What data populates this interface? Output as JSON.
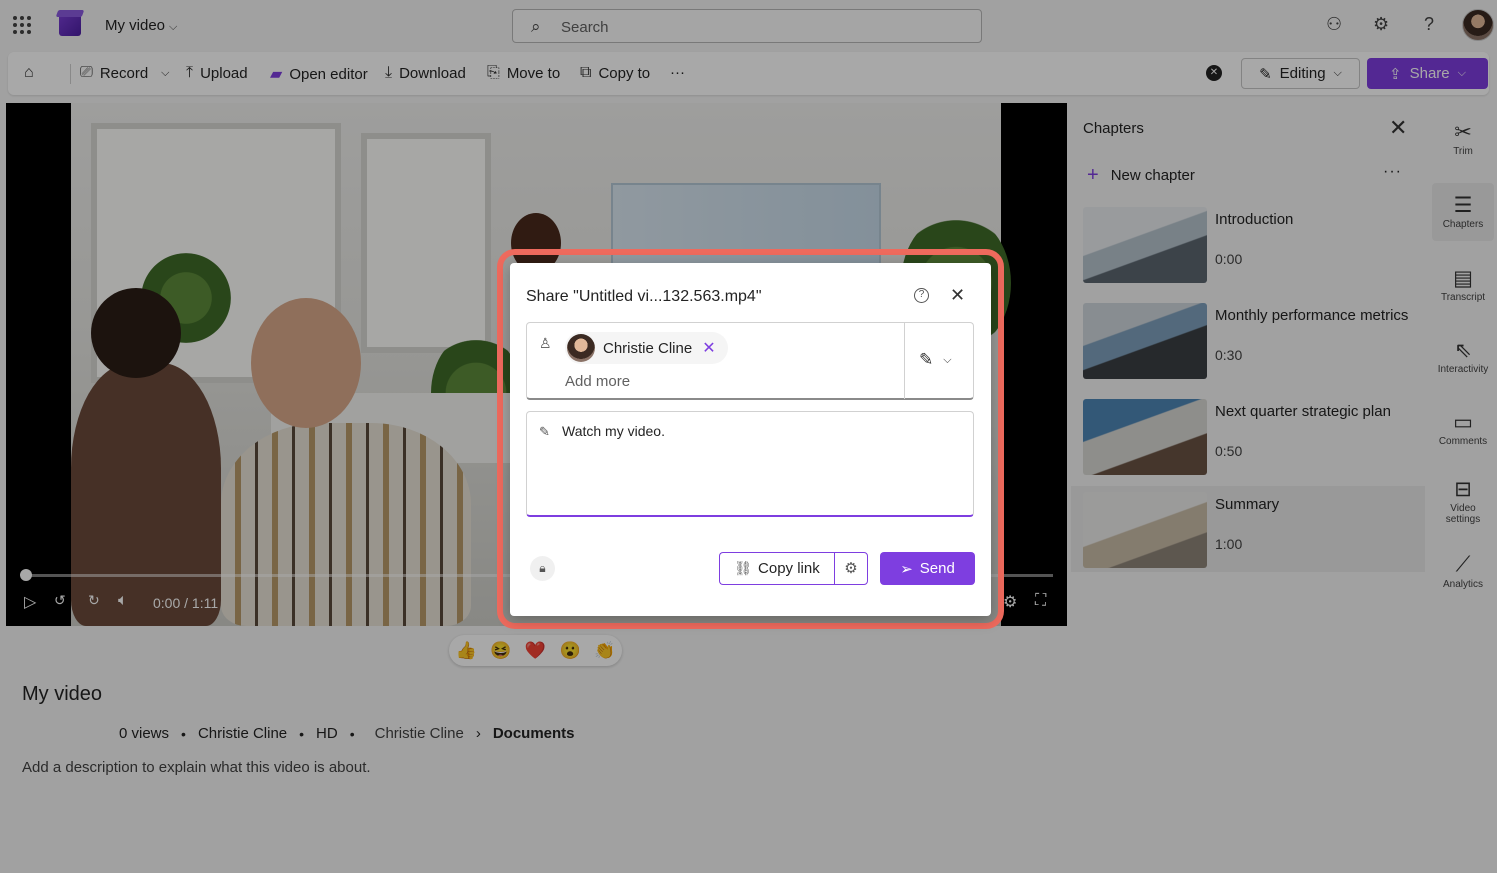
{
  "app": {
    "title": "My video",
    "search_placeholder": "Search"
  },
  "commands": {
    "record": "Record",
    "upload": "Upload",
    "open_editor": "Open editor",
    "download": "Download",
    "move_to": "Move to",
    "copy_to": "Copy to",
    "more": "···",
    "editing": "Editing",
    "share": "Share"
  },
  "player": {
    "time": "0:00 / 1:11",
    "progress_fraction": 0.0
  },
  "reactions": [
    "👍",
    "😆",
    "❤️",
    "😮",
    "👏"
  ],
  "video": {
    "title": "My video",
    "views": "0 views",
    "owner": "Christie Cline",
    "quality": "HD",
    "location_root": "Christie Cline",
    "location_folder": "Documents",
    "description_placeholder": "Add a description to explain what this video is about."
  },
  "chapters": {
    "title": "Chapters",
    "new_chapter": "New chapter",
    "items": [
      {
        "name": "Introduction",
        "time": "0:00"
      },
      {
        "name": "Monthly performance metrics",
        "time": "0:30"
      },
      {
        "name": "Next quarter strategic plan",
        "time": "0:50"
      },
      {
        "name": "Summary",
        "time": "1:00"
      }
    ]
  },
  "rail": {
    "trim": "Trim",
    "chapters": "Chapters",
    "transcript": "Transcript",
    "interactivity": "Interactivity",
    "comments": "Comments",
    "video_settings_1": "Video",
    "video_settings_2": "settings",
    "analytics": "Analytics"
  },
  "share_dialog": {
    "title": "Share \"Untitled vi...132.563.mp4\"",
    "recipient": "Christie Cline",
    "add_more_placeholder": "Add more",
    "message": "Watch my video.",
    "copy_link": "Copy link",
    "send": "Send"
  },
  "colors": {
    "accent": "#7e3ee0",
    "highlight": "#ee6a5d"
  }
}
